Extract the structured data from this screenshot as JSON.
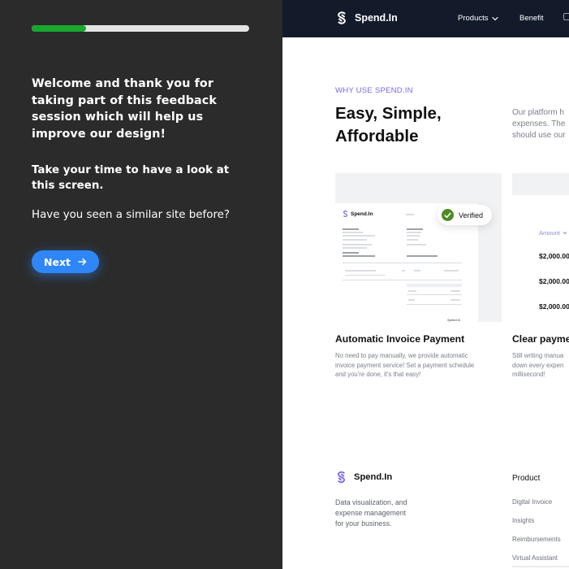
{
  "feedback": {
    "progress_fraction": 0.25,
    "progress_color": "#18a82d",
    "welcome": "Welcome and thank you for taking part of this feedback session which will help us improve our design!",
    "instruction": "Take your time to have a look at this screen.",
    "question": "Have you seen a similar site before?",
    "next_label": "Next",
    "next_icon": "arrow-right-icon",
    "accent": "#2f86f6"
  },
  "site": {
    "nav": {
      "brand": "Spend.In",
      "products": "Products",
      "benefit": "Benefit"
    },
    "hero": {
      "eyebrow": "WHY USE SPEND.IN",
      "headline": "Easy, Simple, Affordable",
      "intro_lines": [
        "Our platform h",
        "expenses. The",
        "should use our"
      ]
    },
    "invoice_preview": {
      "brand": "Spend.In",
      "signature": "Spend.In",
      "verified_label": "Verified"
    },
    "card2_preview": {
      "amount_header": "Amount",
      "amounts": [
        "$2,000.00",
        "$2,000.00",
        "$2,000.00"
      ]
    },
    "cards": [
      {
        "title": "Automatic Invoice Payment",
        "desc_lines": [
          "No need to pay manually, we provide automatic",
          "invoice payment service! Set a payment schedule",
          "and you're done, it's that easy!"
        ]
      },
      {
        "title": "Clear payme",
        "desc_lines": [
          "Still writing manua",
          "down every expen",
          "millisecond!"
        ]
      }
    ],
    "footer": {
      "brand": "Spend.In",
      "desc_lines": [
        "Data visualization, and",
        "expense management",
        "for your business."
      ],
      "product_heading": "Product",
      "product_links": [
        "Digital Invoice",
        "Insights",
        "Reimbursements",
        "Virtual Assistant"
      ]
    },
    "colors": {
      "nav_bg": "#131b2b",
      "eyebrow": "#7f66ea",
      "brand_icon": "#7f66ea"
    }
  }
}
